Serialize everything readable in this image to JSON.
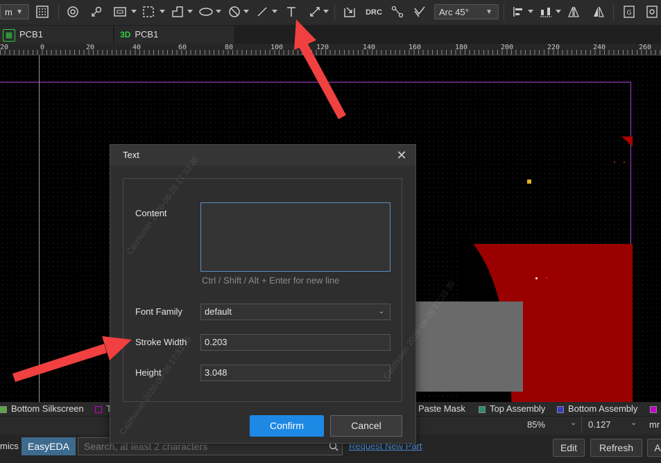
{
  "toolbar": {
    "unit_select": "m",
    "arc_mode": "Arc 45°",
    "drc_label": "DRC",
    "icons": [
      "grid-icon",
      "via-icon",
      "pin-icon",
      "rect-region-icon",
      "select-region-icon",
      "polygon-icon",
      "ellipse-icon",
      "no-circle-icon",
      "line-icon",
      "text-icon",
      "dimension-icon",
      "import-icon",
      "drc-icon",
      "route-icon",
      "diff-pair-icon",
      "align-icon",
      "distribute-icon",
      "flip-icon",
      "mirror-icon",
      "gerber-icon",
      "settings-icon"
    ]
  },
  "tabs": [
    {
      "label": "PCB1",
      "badge": "2D"
    },
    {
      "label": "PCB1",
      "badge": "3D"
    }
  ],
  "ruler": {
    "labels": [
      "20",
      "0",
      "20",
      "40",
      "60",
      "80",
      "100",
      "120",
      "140",
      "160",
      "180",
      "200",
      "220",
      "240",
      "260"
    ]
  },
  "layers": [
    {
      "label": "Bottom Silkscreen",
      "color": "#59a83e"
    },
    {
      "label": "T",
      "color": "#c800c8"
    },
    {
      "label": "Paste Mask",
      "color": ""
    },
    {
      "label": "Top Assembly",
      "color": "#2e8b6a"
    },
    {
      "label": "Bottom Assembly",
      "color": "#3a3ac8"
    },
    {
      "label": "",
      "color": "#c800c8"
    }
  ],
  "statusbar": {
    "zoom": "85%",
    "grid_value": "0.127",
    "unit": "mr"
  },
  "bottombar": {
    "tab_left": "mics",
    "tab_easyeda": "EasyEDA",
    "search_placeholder": "Search, at least 2 characters",
    "link": "Request New Part",
    "edit": "Edit",
    "refresh": "Refresh",
    "more": "A"
  },
  "dialog": {
    "title": "Text",
    "content_label": "Content",
    "content_value": "",
    "hint": "Ctrl / Shift / Alt + Enter for new line",
    "font_family_label": "Font Family",
    "font_family_value": "default",
    "stroke_width_label": "Stroke Width",
    "stroke_width_value": "0.203",
    "height_label": "Height",
    "height_value": "3.048",
    "confirm": "Confirm",
    "cancel": "Cancel"
  },
  "watermark": "Caizhuixin  2026-08-26 17:33:35"
}
